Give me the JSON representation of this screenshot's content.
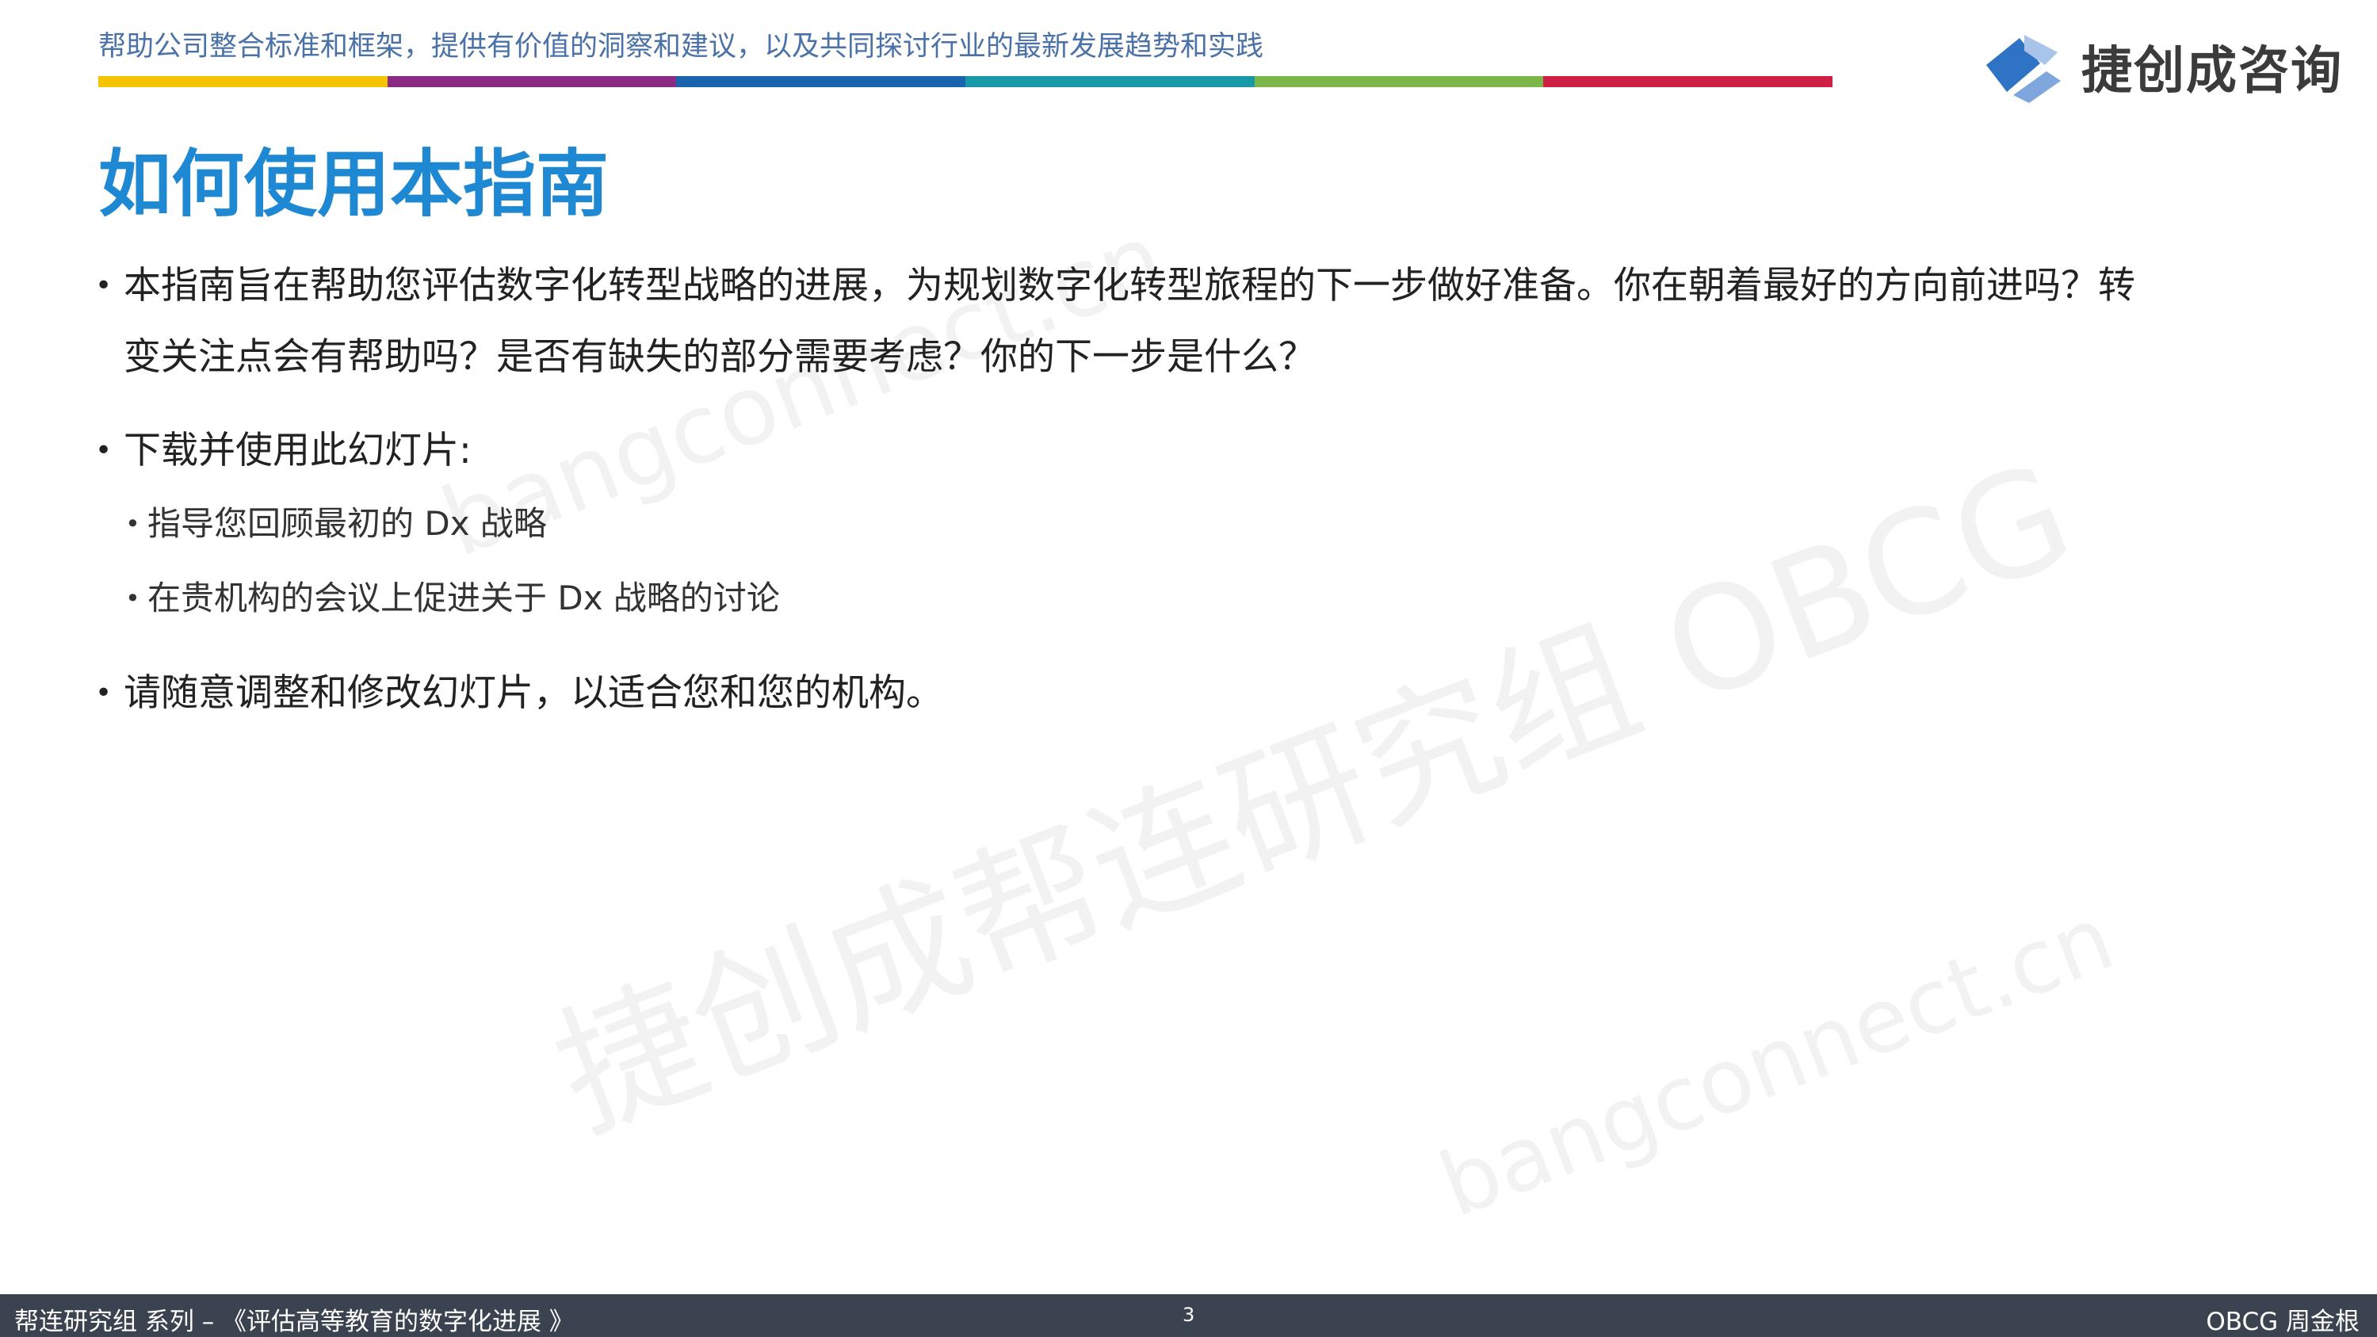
{
  "header": {
    "tagline": "帮助公司整合标准和框架，提供有价值的洞察和建议，以及共同探讨行业的最新发展趋势和实践",
    "color_bar": [
      "#f5c400",
      "#8a2a82",
      "#1a63ad",
      "#1799a8",
      "#7ab648",
      "#cf1f45"
    ],
    "logo": {
      "icon": "cube-logo-icon",
      "text": "捷创成咨询",
      "colors": [
        "#2f73c4",
        "#7fa7dd",
        "#a9c4ea"
      ]
    }
  },
  "title": "如何使用本指南",
  "bullets": [
    {
      "text": "本指南旨在帮助您评估数字化转型战略的进展，为规划数字化转型旅程的下一步做好准备。你在朝着最好的方向前进吗？转变关注点会有帮助吗？是否有缺失的部分需要考虑？你的下一步是什么？",
      "line1": "本指南旨在帮助您评估数字化转型战略的进展，为规划数字化转型旅程的下一步做好准备。你在朝着最好的方向前进吗？转",
      "line2": "变关注点会有帮助吗？是否有缺失的部分需要考虑？你的下一步是什么？"
    },
    {
      "text": "下载并使用此幻灯片:",
      "sub": [
        "指导您回顾最初的 Dx 战略",
        "在贵机构的会议上促进关于 Dx 战略的讨论"
      ]
    },
    {
      "text": "请随意调整和修改幻灯片，以适合您和您的机构。"
    }
  ],
  "watermarks": {
    "main": "捷创成帮连研究组 OBCG",
    "url_upper": "bangconnect.cn",
    "url_lower": "bangconnect.cn"
  },
  "footer": {
    "left": "帮连研究组 系列  – 《评估高等教育的数字化进展 》",
    "page": "3",
    "right": "OBCG 周金根",
    "bg": "#3c4350"
  }
}
